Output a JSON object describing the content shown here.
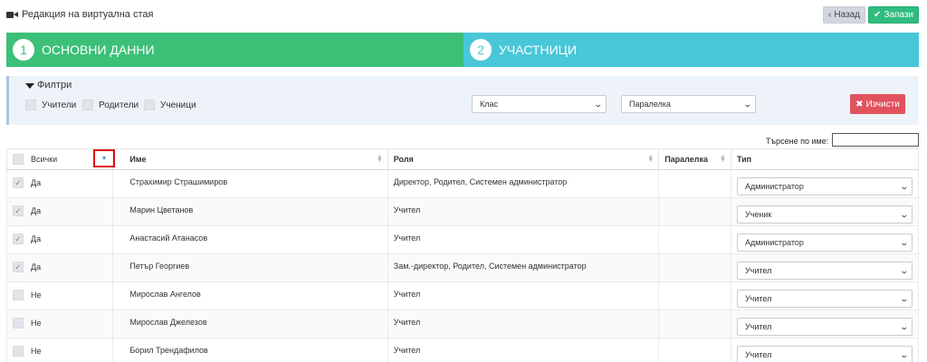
{
  "header": {
    "title": "Редакция на виртуална стая",
    "back_label": "Назад",
    "save_label": "Запази"
  },
  "steps": [
    {
      "number": "1",
      "label": "ОСНОВНИ ДАННИ"
    },
    {
      "number": "2",
      "label": "УЧАСТНИЦИ"
    }
  ],
  "filters": {
    "title": "Филтри",
    "checkboxes": [
      "Учители",
      "Родители",
      "Ученици"
    ],
    "class_select": "Клас",
    "section_select": "Паралелка",
    "clear_label": "Изчисти"
  },
  "search": {
    "label": "Търсене по име:",
    "value": ""
  },
  "table": {
    "headers": {
      "all": "Всички",
      "name": "Име",
      "role": "Роля",
      "section": "Паралелка",
      "type": "Тип"
    },
    "rows": [
      {
        "included": "Да",
        "name": "Страхимир Страшимиров",
        "role": "Директор, Родител, Системен администратор",
        "section": "",
        "type": "Администратор"
      },
      {
        "included": "Да",
        "name": "Марин Цветанов",
        "role": "Учител",
        "section": "",
        "type": "Ученик"
      },
      {
        "included": "Да",
        "name": "Анастасий Атанасов",
        "role": "Учител",
        "section": "",
        "type": "Администратор"
      },
      {
        "included": "Да",
        "name": "Петър Георгиев",
        "role": "Зам.-директор, Родител, Системен администратор",
        "section": "",
        "type": "Учител"
      },
      {
        "included": "Не",
        "name": "Мирослав Ангелов",
        "role": "Учител",
        "section": "",
        "type": "Учител"
      },
      {
        "included": "Не",
        "name": "Мирослав Джелезов",
        "role": "Учител",
        "section": "",
        "type": "Учител"
      },
      {
        "included": "Не",
        "name": "Борил Трендафилов",
        "role": "Учител",
        "section": "",
        "type": "Учител"
      }
    ]
  },
  "colors": {
    "step1": "#3cc077",
    "step2": "#48c7d9",
    "save": "#2fbc7f",
    "clear": "#e0525e",
    "highlight": "#e0101a"
  }
}
